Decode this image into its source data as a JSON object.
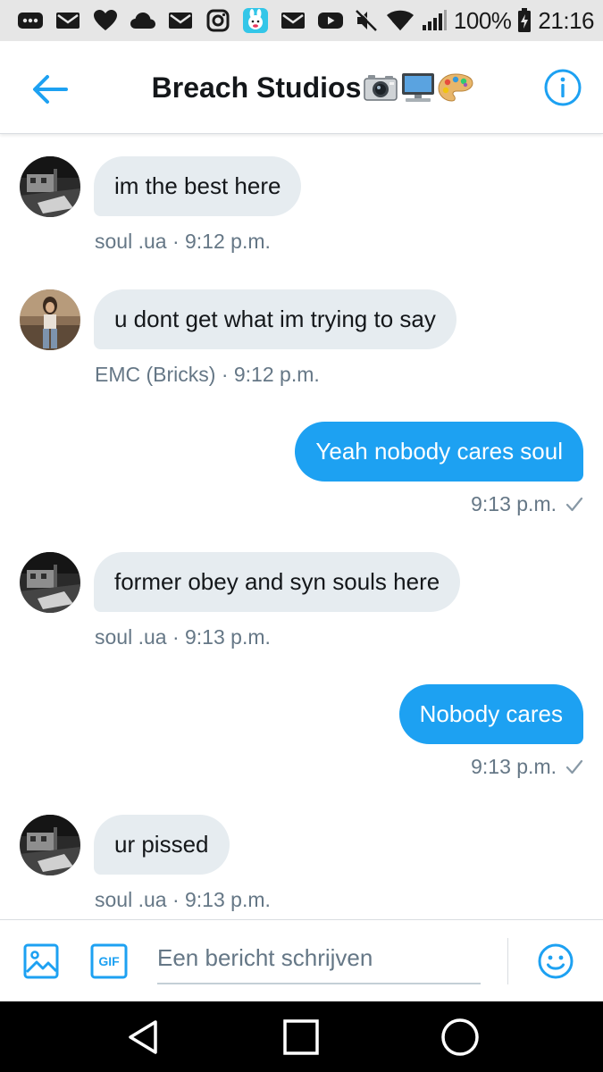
{
  "status_bar": {
    "battery": "100%",
    "time": "21:16",
    "notification_icons": [
      "more-icon",
      "mail-icon",
      "heart-icon",
      "cloud-icon",
      "mail-icon",
      "instagram-icon",
      "app-icon",
      "mail-icon",
      "youtube-icon"
    ],
    "system_icons": [
      "mute-icon",
      "wifi-icon",
      "signal-icon",
      "battery-icon"
    ]
  },
  "header": {
    "title": "Breach Studios",
    "title_emojis": [
      "camera-icon",
      "computer-icon",
      "palette-icon"
    ]
  },
  "messages": [
    {
      "direction": "in",
      "text": "im the best here",
      "meta": "soul .ua · 9:12 p.m."
    },
    {
      "direction": "in",
      "text": "u dont get what im trying to say",
      "meta": "EMC (Bricks) · 9:12 p.m."
    },
    {
      "direction": "out",
      "text": "Yeah nobody cares soul",
      "meta": "9:13 p.m."
    },
    {
      "direction": "in",
      "text": "former obey and syn souls here",
      "meta": "soul .ua · 9:13 p.m."
    },
    {
      "direction": "out",
      "text": "Nobody cares",
      "meta": "9:13 p.m."
    },
    {
      "direction": "in",
      "text": "ur pissed",
      "meta": "soul .ua · 9:13 p.m."
    }
  ],
  "composer": {
    "placeholder": "Een bericht schrijven",
    "value": "",
    "gif_label": "GIF"
  },
  "colors": {
    "accent": "#1da1f2",
    "incoming_bubble": "#e6ecf0",
    "meta_text": "#657786",
    "status_bar": "#e6e6e6",
    "nav_bar": "#000000"
  }
}
